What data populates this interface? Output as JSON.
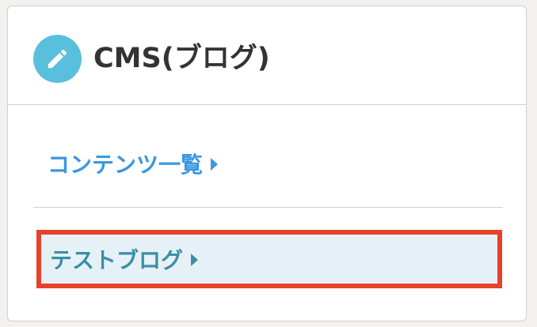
{
  "panel": {
    "title": "CMS(ブログ)",
    "icon": "pencil-icon"
  },
  "menu": {
    "items": [
      {
        "label": "コンテンツ一覧",
        "state": "normal"
      },
      {
        "label": "テストブログ",
        "state": "highlighted"
      }
    ]
  },
  "colors": {
    "icon_bg": "#58bfdc",
    "link": "#3a97e0",
    "highlight_bg": "#e6f1f7",
    "highlight_border": "#e8412a",
    "highlight_text": "#3a8fa6"
  }
}
